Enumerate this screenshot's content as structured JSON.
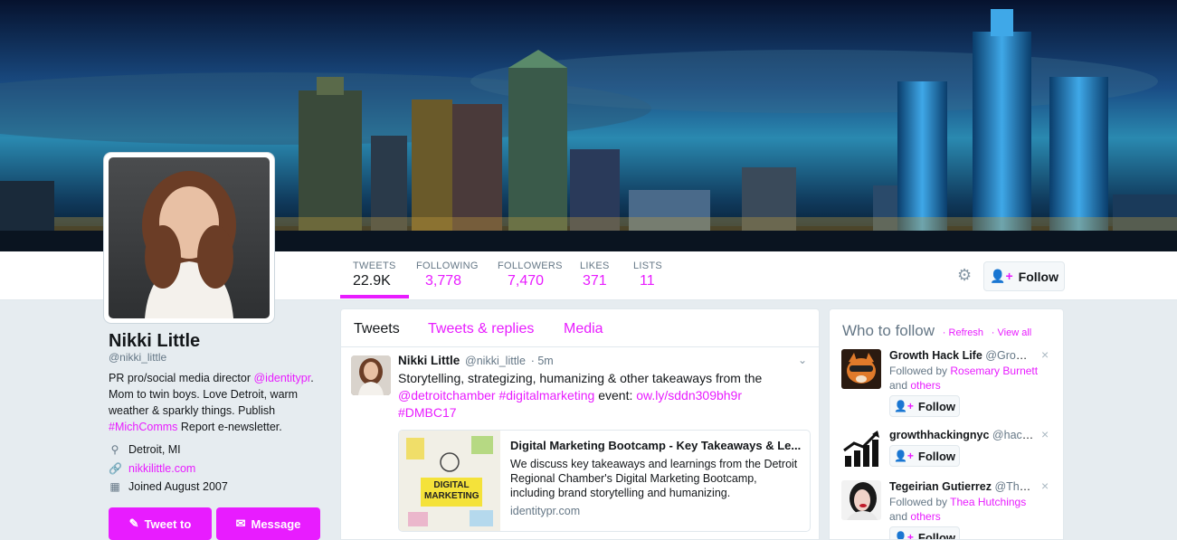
{
  "profile": {
    "name": "Nikki Little",
    "handle": "@nikki_little",
    "bio_pre": "PR pro/social media director ",
    "bio_mention": "@identitypr",
    "bio_mid": ". Mom to twin boys. Love Detroit, warm weather & sparkly things. Publish ",
    "bio_tag": "#MichComms",
    "bio_post": " Report e-newsletter.",
    "location": "Detroit, MI",
    "website": "nikkilittle.com",
    "joined": "Joined August 2007",
    "tweet_to_label": "Tweet to",
    "message_label": "Message"
  },
  "stats": {
    "tweets_label": "TWEETS",
    "tweets_value": "22.9K",
    "following_label": "FOLLOWING",
    "following_value": "3,778",
    "followers_label": "FOLLOWERS",
    "followers_value": "7,470",
    "likes_label": "LIKES",
    "likes_value": "371",
    "lists_label": "LISTS",
    "lists_value": "11"
  },
  "actions": {
    "follow_label": "Follow",
    "gear_icon": "gear-icon"
  },
  "tabs": [
    {
      "label": "Tweets"
    },
    {
      "label": "Tweets & replies"
    },
    {
      "label": "Media"
    }
  ],
  "tweet": {
    "name": "Nikki Little",
    "handle": "@nikki_little",
    "time": "· 5m",
    "text_pre": "Storytelling, strategizing, humanizing & other takeaways from the ",
    "mention": "@detroitchamber",
    "hashtag1": "#digitalmarketing",
    "text_mid": " event: ",
    "link": "ow.ly/sddn309bh9r",
    "hashtag2": "#DMBC17",
    "card": {
      "title": "Digital Marketing Bootcamp - Key Takeaways & Le...",
      "description": "We discuss key takeaways and learnings from the Detroit Regional Chamber's Digital Marketing Bootcamp, including brand storytelling and humanizing.",
      "url": "identitypr.com",
      "image_text": "DIGITAL MARKETING"
    }
  },
  "who_to_follow": {
    "title": "Who to follow",
    "refresh": "Refresh",
    "view_all": "View all",
    "follow_label": "Follow",
    "items": [
      {
        "name": "Growth Hack Life",
        "handle": "@Growth...",
        "followed_by": "Followed by ",
        "f1": "Rosemary Burnett",
        "and": " and ",
        "f2": "others"
      },
      {
        "name": "growthhackingnyc",
        "handle": "@hacke..."
      },
      {
        "name": "Tegeirian Gutierrez",
        "handle": "@TheT...",
        "followed_by": "Followed by ",
        "f1": "Thea Hutchings",
        "and": " and ",
        "f2": "others"
      }
    ]
  },
  "colors": {
    "accent": "#e81cff",
    "text": "#14171a",
    "muted": "#657786",
    "bg": "#e6ecf0"
  }
}
